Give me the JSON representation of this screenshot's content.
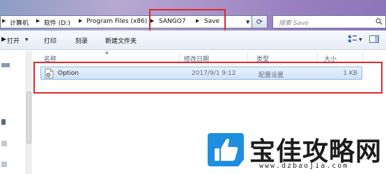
{
  "breadcrumb": {
    "items": [
      "计算机",
      "软件 (D:)",
      "Program Files (x86)",
      "SANGO7",
      "Save"
    ]
  },
  "search": {
    "placeholder": "搜索 Save"
  },
  "toolbar": {
    "open_label": "打开",
    "print_label": "打印",
    "burn_label": "刻录",
    "new_folder_label": "新建文件夹"
  },
  "columns": {
    "name": "名称",
    "modified": "修改日期",
    "type": "类型",
    "size": "大小"
  },
  "files": [
    {
      "name": "Option",
      "modified": "2017/9/1 9:12",
      "type": "配置设置",
      "size": "1 KB"
    }
  ],
  "watermark": {
    "title": "宝佳攻略网",
    "url": "www.dzbaojia.com"
  },
  "colors": {
    "highlight_red": "#e0262c",
    "selection_blue": "#cfe3f8",
    "logo_blue": "#1e8fe0"
  }
}
